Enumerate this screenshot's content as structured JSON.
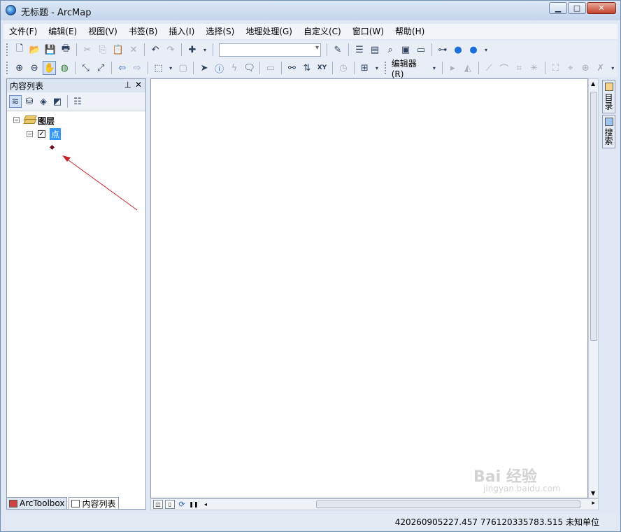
{
  "window": {
    "title": "无标题 - ArcMap"
  },
  "menu": [
    "文件(F)",
    "编辑(E)",
    "视图(V)",
    "书签(B)",
    "插入(I)",
    "选择(S)",
    "地理处理(G)",
    "自定义(C)",
    "窗口(W)",
    "帮助(H)"
  ],
  "toolbar": {
    "editor_label": "编辑器(R)"
  },
  "toc": {
    "title": "内容列表",
    "root_label": "图层",
    "layer_label": "点"
  },
  "bottom_tabs": [
    "ArcToolbox",
    "内容列表"
  ],
  "side_tabs": [
    "目录",
    "搜索"
  ],
  "status": {
    "coordinates": "420260905227.457  776120335783.515 未知单位"
  },
  "watermark": {
    "text": "Bai 经验",
    "sub": "jingyan.baidu.com"
  }
}
